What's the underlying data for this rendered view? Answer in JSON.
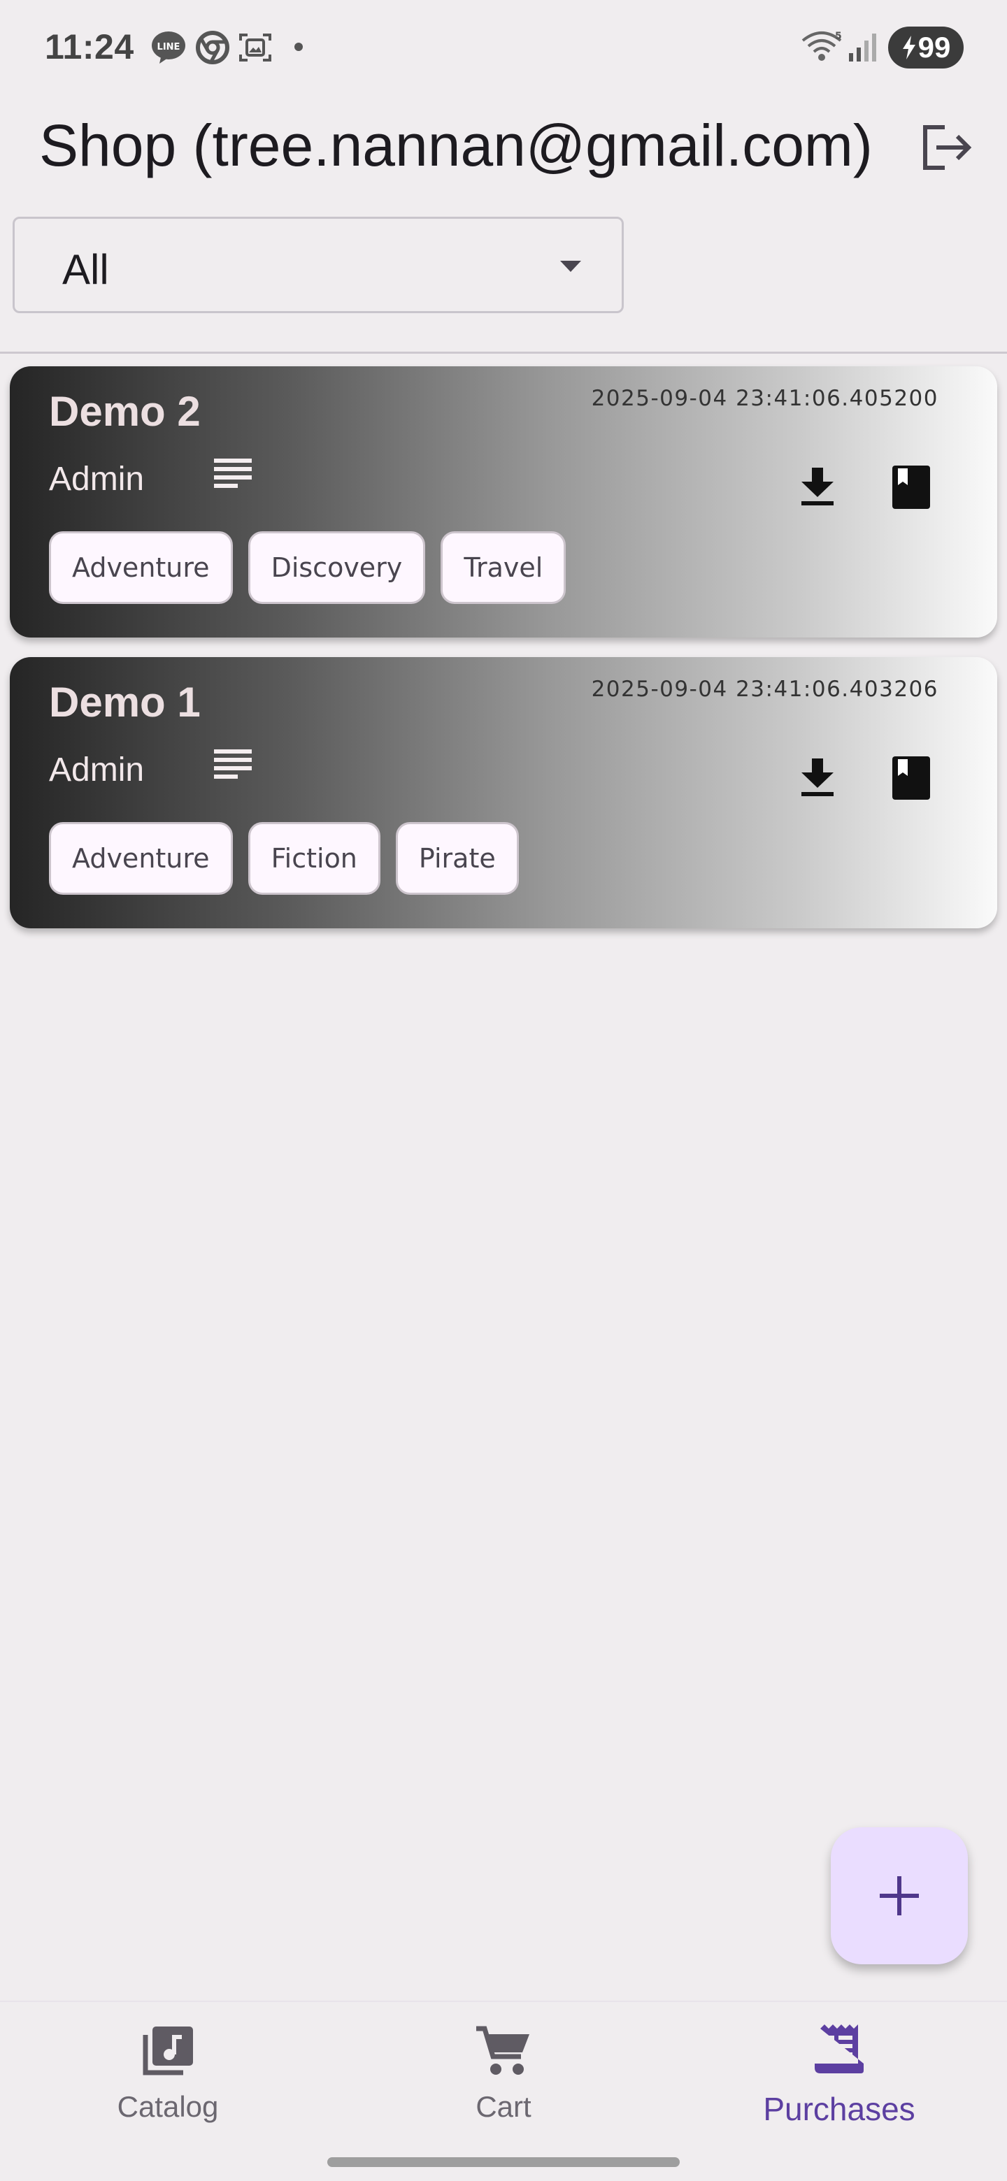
{
  "status_bar": {
    "time": "11:24",
    "battery": "99",
    "icons": [
      "line-icon",
      "chrome-icon",
      "screenshot-icon",
      "dot-icon",
      "wifi-icon",
      "signal-icon",
      "battery-charging-icon"
    ]
  },
  "app_bar": {
    "title": "Shop (tree.nannan@gmail.com)",
    "logout_icon": "logout-icon"
  },
  "filter": {
    "selected": "All"
  },
  "cards": [
    {
      "title": "Demo 2",
      "date": "2025-09-04 23:41:06.405200",
      "author": "Admin",
      "tags": [
        "Adventure",
        "Discovery",
        "Travel"
      ]
    },
    {
      "title": "Demo 1",
      "date": "2025-09-04 23:41:06.403206",
      "author": "Admin",
      "tags": [
        "Adventure",
        "Fiction",
        "Pirate"
      ]
    }
  ],
  "fab": {
    "icon": "plus-icon"
  },
  "bottom_nav": {
    "items": [
      {
        "label": "Catalog",
        "icon": "library-music-icon",
        "active": false
      },
      {
        "label": "Cart",
        "icon": "cart-icon",
        "active": false
      },
      {
        "label": "Purchases",
        "icon": "receipt-icon",
        "active": true
      }
    ]
  },
  "colors": {
    "background": "#f0edef",
    "accent": "#5c3fa1",
    "fab_background": "#eaddff",
    "tag_background": "#fef7ff"
  }
}
